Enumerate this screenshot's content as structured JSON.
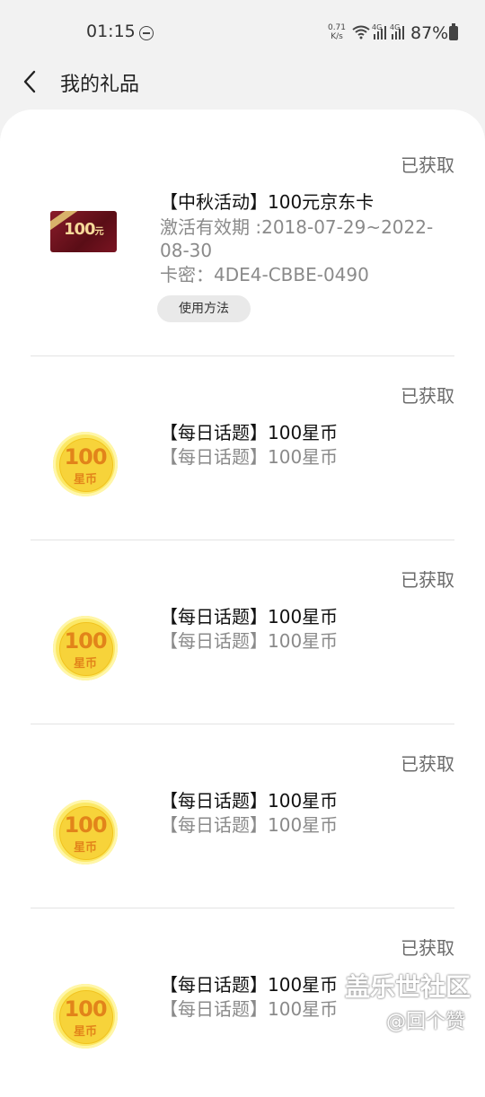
{
  "status_bar": {
    "time": "01:15",
    "net_speed_value": "0.71",
    "net_speed_unit": "K/s",
    "network_type": "4G",
    "battery": "87%"
  },
  "header": {
    "title": "我的礼品"
  },
  "gifts": [
    {
      "status": "已获取",
      "title": "【中秋活动】100元京东卡",
      "validity_line1": "激活有效期 :2018-07-29~2022-",
      "validity_line2": "08-30",
      "card_key": "卡密：4DE4-CBBE-0490",
      "usage_button": "使用方法",
      "image_amount": "100",
      "image_unit": "元",
      "icon": "jd-gift-card-icon"
    },
    {
      "status": "已获取",
      "title": "【每日话题】100星币",
      "subtitle": "【每日话题】100星币",
      "coin_amount": "100",
      "coin_label": "星币",
      "icon": "star-coin-icon"
    },
    {
      "status": "已获取",
      "title": "【每日话题】100星币",
      "subtitle": "【每日话题】100星币",
      "coin_amount": "100",
      "coin_label": "星币",
      "icon": "star-coin-icon"
    },
    {
      "status": "已获取",
      "title": "【每日话题】100星币",
      "subtitle": "【每日话题】100星币",
      "coin_amount": "100",
      "coin_label": "星币",
      "icon": "star-coin-icon"
    },
    {
      "status": "已获取",
      "title": "【每日话题】100星币",
      "subtitle": "【每日话题】100星币",
      "coin_amount": "100",
      "coin_label": "星币",
      "icon": "star-coin-icon"
    }
  ],
  "watermark": {
    "brand": "盖乐世社区",
    "user": "@回个赞"
  }
}
